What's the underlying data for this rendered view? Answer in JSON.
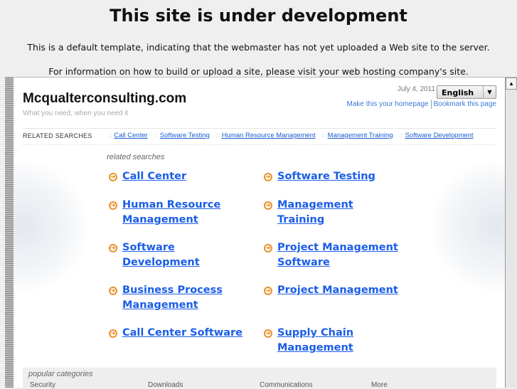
{
  "notice": {
    "title": "This site is under development",
    "line1": "This is a default template, indicating that the webmaster has not yet uploaded a Web site to the server.",
    "line2": "For information on how to build or upload a site, please visit your web hosting company's site."
  },
  "site": {
    "name": "Mcqualterconsulting.com",
    "tagline": "What you need, when you need it",
    "date": "July 4, 2011",
    "language": "English",
    "make_homepage": "Make this your homepage",
    "bookmark": "Bookmark this page"
  },
  "related_bar": {
    "label": "RELATED SEARCHES",
    "links": [
      "Call Center",
      "Software Testing",
      "Human Resource Management",
      "Management Training",
      "Software Development"
    ]
  },
  "related": {
    "title": "related searches",
    "links": [
      "Call Center",
      "Software Testing",
      "Human Resource Management",
      "Management Training",
      "Software Development",
      "Project Management Software",
      "Business Process Management",
      "Project Management",
      "Call Center Software",
      "Supply Chain Management"
    ]
  },
  "popular": {
    "title": "popular categories",
    "items": [
      "Security",
      "Downloads",
      "Communications",
      "More"
    ]
  }
}
